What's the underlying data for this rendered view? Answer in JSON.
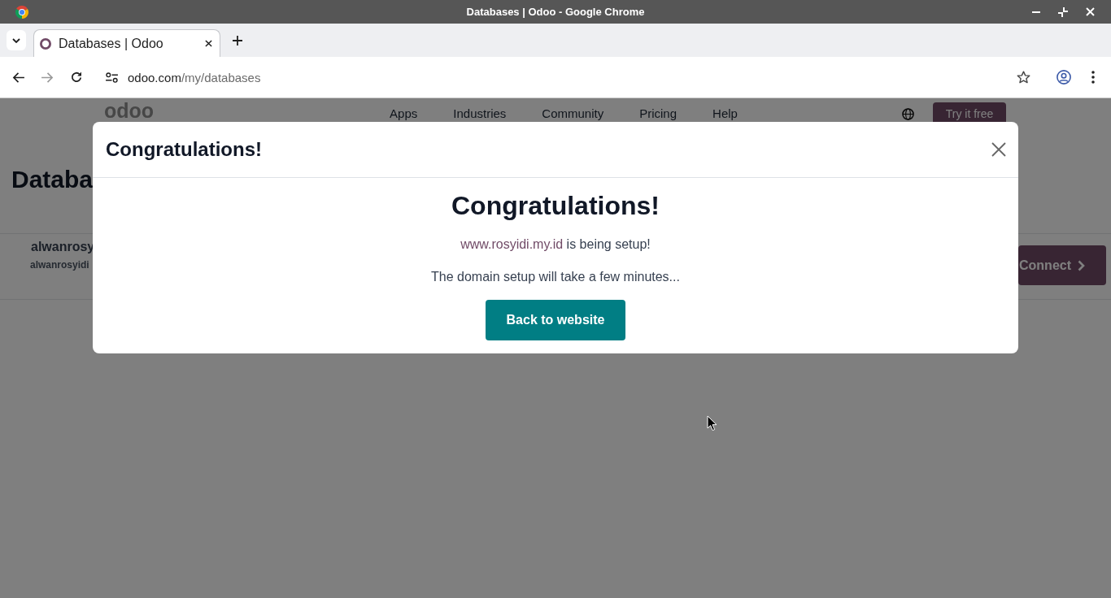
{
  "window": {
    "title": "Databases | Odoo - Google Chrome"
  },
  "tabs": [
    {
      "title": "Databases | Odoo",
      "selected": true
    }
  ],
  "toolbar": {
    "nav_buttons": [
      {
        "kind": "back",
        "disabled": false
      },
      {
        "kind": "forward",
        "disabled": true
      },
      {
        "kind": "reload",
        "disabled": false
      }
    ],
    "address": {
      "host": "odoo.com",
      "path": "/my/databases"
    }
  },
  "site": {
    "logo": "odoo",
    "nav": [
      "Apps",
      "Industries",
      "Community",
      "Pricing",
      "Help"
    ],
    "cta": "Try it free",
    "heading": "Databa",
    "databases": [
      {
        "name": "alwanrosy",
        "url": "alwanrosyidi",
        "action": "Connect"
      }
    ]
  },
  "dialog": {
    "title": "Congratulations!",
    "heading": "Congratulations!",
    "domain": "www.rosyidi.my.id",
    "status": "is being setup!",
    "note": "The domain setup will take a few minutes...",
    "button": "Back to website"
  }
}
